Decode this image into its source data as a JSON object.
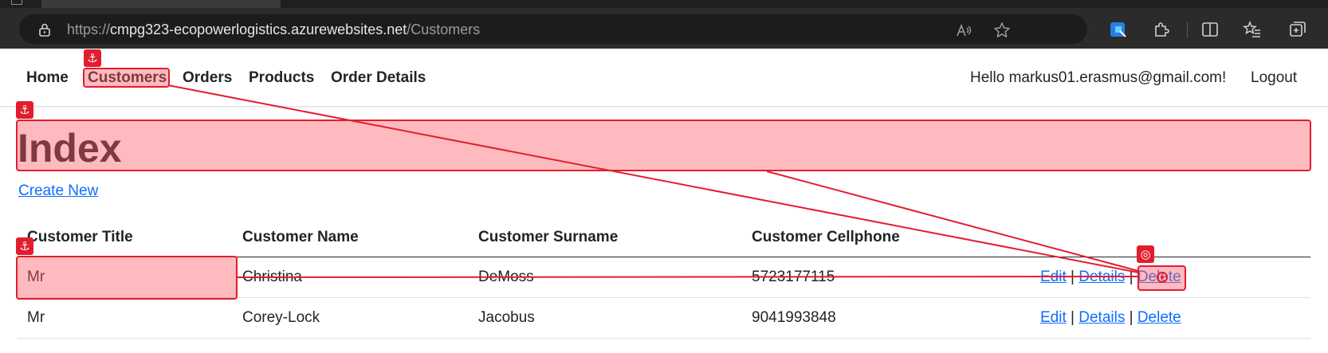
{
  "browser": {
    "url_protocol": "https://",
    "url_host": "cmpg323-ecopowerlogistics.azurewebsites.net",
    "url_path": "/Customers"
  },
  "navbar": {
    "items": [
      {
        "label": "Home"
      },
      {
        "label": "Customers"
      },
      {
        "label": "Orders"
      },
      {
        "label": "Products"
      },
      {
        "label": "Order Details"
      }
    ],
    "greeting": "Hello markus01.erasmus@gmail.com!",
    "logout": "Logout"
  },
  "page": {
    "title": "Index",
    "create_link": "Create New"
  },
  "table": {
    "headers": [
      "Customer Title",
      "Customer Name",
      "Customer Surname",
      "Customer Cellphone"
    ],
    "rows": [
      {
        "title": "Mr",
        "name": "Christina",
        "surname": "DeMoss",
        "cellphone": "5723177115"
      },
      {
        "title": "Mr",
        "name": "Corey-Lock",
        "surname": "Jacobus",
        "cellphone": "9041993848"
      }
    ],
    "actions": {
      "edit": "Edit",
      "details": "Details",
      "delete": "Delete",
      "separator": "|"
    }
  },
  "annotations": {
    "anchor_glyph": "⚓",
    "target_glyph": "◎",
    "highlight_color": "#e21d2e"
  }
}
